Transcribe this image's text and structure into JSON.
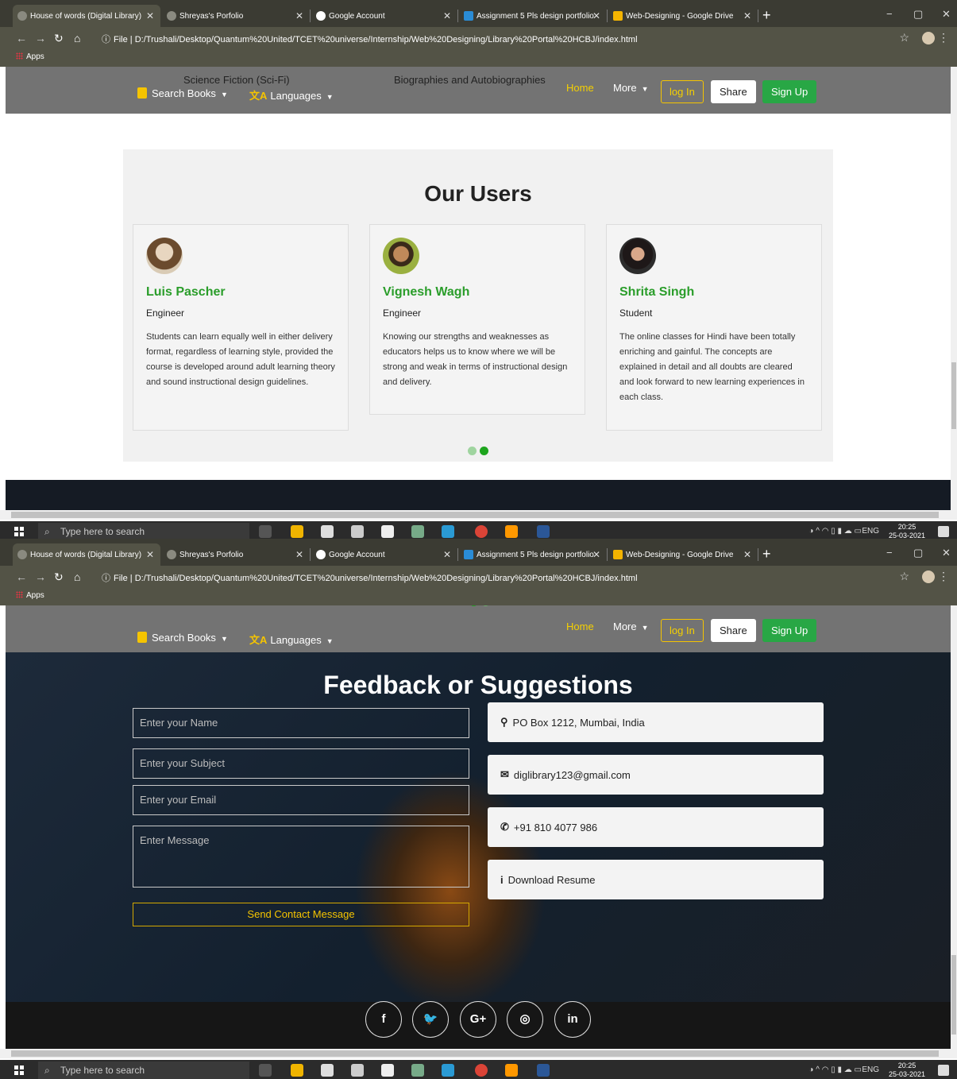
{
  "browser": {
    "tabs": [
      {
        "title": "House of words (Digital Library)",
        "active": true
      },
      {
        "title": "Shreyas's Porfolio",
        "active": false
      },
      {
        "title": "Google Account",
        "active": false
      },
      {
        "title": "Assignment 5 Pls design portfolio",
        "active": false
      },
      {
        "title": "Web-Designing - Google Drive",
        "active": false
      }
    ],
    "new_tab": "+",
    "window_controls": {
      "minimize": "−",
      "maximize": "▢",
      "close": "✕"
    },
    "address": {
      "info_label": "File",
      "url": "D:/Trushali/Desktop/Quantum%20United/TCET%20universe/Internship/Web%20Designing/Library%20Portal%20HCBJ/index.html"
    },
    "bookmarks": {
      "apps_label": "Apps"
    }
  },
  "navbar": {
    "search_books": "Search Books",
    "languages": "Languages",
    "dropdown_items": [
      "Science Fiction (Sci-Fi)",
      "Biographies and Autobiographies"
    ],
    "home": "Home",
    "more": "More",
    "login": "log In",
    "share": "Share",
    "signup": "Sign Up"
  },
  "users_section": {
    "title": "Our Users",
    "users": [
      {
        "name": "Luis Pascher",
        "role": "Engineer",
        "quote": "Students can learn equally well in either delivery format, regardless of learning style, provided the course is developed around adult learning theory and sound instructional design guidelines."
      },
      {
        "name": "Vignesh Wagh",
        "role": "Engineer",
        "quote": "Knowing our strengths and weaknesses as educators helps us to know where we will be strong and weak in terms of instructional design and delivery."
      },
      {
        "name": "Shrita Singh",
        "role": "Student",
        "quote": "The online classes for Hindi have been totally enriching and gainful. The concepts are explained in detail and all doubts are cleared and look forward to new learning experiences in each class."
      }
    ],
    "carousel_active_index": 1
  },
  "feedback": {
    "title": "Feedback or Suggestions",
    "name_placeholder": "Enter your Name",
    "subject_placeholder": "Enter your Subject",
    "email_placeholder": "Enter your Email",
    "message_placeholder": "Enter Message",
    "send_label": "Send Contact Message",
    "address": "PO Box 1212, Mumbai, India",
    "email": "diglibrary123@gmail.com",
    "phone": "+91 810 4077 986",
    "download": "Download Resume"
  },
  "social": {
    "icons": [
      {
        "name": "facebook",
        "glyph": "f"
      },
      {
        "name": "twitter",
        "glyph": "🐦"
      },
      {
        "name": "google-plus",
        "glyph": "G+"
      },
      {
        "name": "instagram",
        "glyph": "◎"
      },
      {
        "name": "linkedin",
        "glyph": "in"
      }
    ]
  },
  "taskbar": {
    "search_placeholder": "Type here to search",
    "language": "ENG",
    "time": "20:25",
    "date": "25-03-2021"
  },
  "colors": {
    "accent_green": "#28a745",
    "accent_yellow": "#f5c400",
    "navbar_bg": "#737373"
  }
}
